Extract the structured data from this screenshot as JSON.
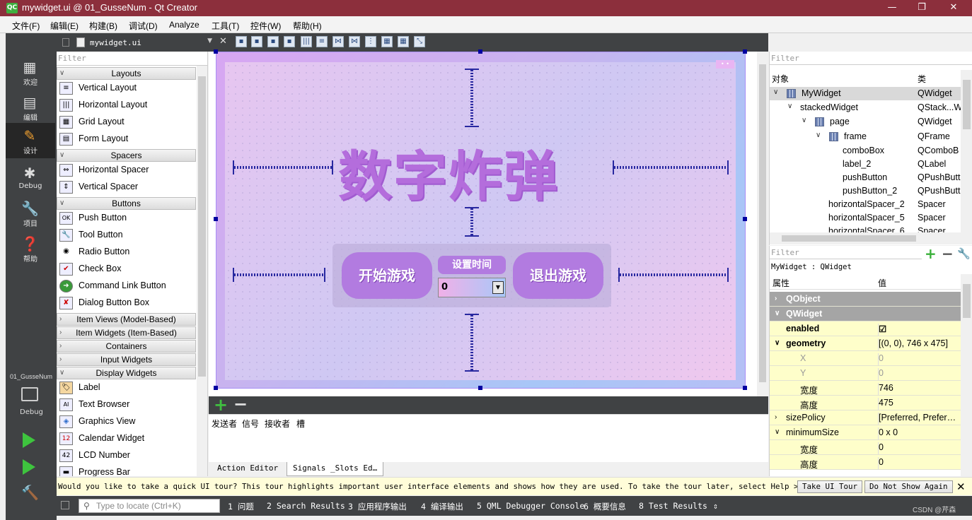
{
  "window": {
    "app_icon": "QC",
    "title": "mywidget.ui @ 01_GusseNum - Qt Creator",
    "min": "—",
    "max": "❐",
    "close": "✕",
    "title_color": "#8c2f3c"
  },
  "menu": [
    "文件(F)",
    "编辑(E)",
    "构建(B)",
    "调试(D)",
    "Analyze",
    "工具(T)",
    "控件(W)",
    "帮助(H)"
  ],
  "modes": [
    {
      "label": "欢迎",
      "icon": "grid-icon"
    },
    {
      "label": "编辑",
      "icon": "document-icon"
    },
    {
      "label": "设计",
      "icon": "pencil-icon"
    },
    {
      "label": "Debug",
      "icon": "bug-icon"
    },
    {
      "label": "项目",
      "icon": "wrench-icon"
    },
    {
      "label": "帮助",
      "icon": "help-icon"
    }
  ],
  "project_name": "01_GusseNum",
  "project_mode": "Debug",
  "doc": {
    "file": "mywidget.ui"
  },
  "widgetbox": {
    "filter_placeholder": "Filter",
    "categories": {
      "layouts": "Layouts",
      "spacers": "Spacers",
      "buttons": "Buttons",
      "item_views": "Item Views (Model-Based)",
      "item_widgets": "Item Widgets (Item-Based)",
      "containers": "Containers",
      "input_widgets": "Input Widgets",
      "display_widgets": "Display Widgets"
    },
    "items": {
      "vertical_layout": "Vertical Layout",
      "horizontal_layout": "Horizontal Layout",
      "grid_layout": "Grid Layout",
      "form_layout": "Form Layout",
      "horizontal_spacer": "Horizontal Spacer",
      "vertical_spacer": "Vertical Spacer",
      "push_button": "Push Button",
      "tool_button": "Tool Button",
      "radio_button": "Radio Button",
      "check_box": "Check Box",
      "command_link_button": "Command Link Button",
      "dialog_button_box": "Dialog Button Box",
      "label": "Label",
      "text_browser": "Text Browser",
      "graphics_view": "Graphics View",
      "calendar_widget": "Calendar Widget",
      "lcd_number": "LCD Number",
      "progress_bar": "Progress Bar"
    }
  },
  "form": {
    "title": "数字炸弹",
    "start_button": "开始游戏",
    "set_time_label": "设置时间",
    "combo_value": "0",
    "quit_button": "退出游戏"
  },
  "signals": {
    "headers": [
      "发送者",
      "信号",
      "接收者",
      "槽"
    ],
    "tabs": [
      "Action Editor",
      "Signals _Slots Ed…"
    ]
  },
  "object_inspector": {
    "filter_placeholder": "Filter",
    "col_object": "对象",
    "col_class": "类",
    "rows": [
      {
        "name": "MyWidget",
        "class": "QWidget"
      },
      {
        "name": "stackedWidget",
        "class": "QStack...W"
      },
      {
        "name": "page",
        "class": "QWidget"
      },
      {
        "name": "frame",
        "class": "QFrame"
      },
      {
        "name": "comboBox",
        "class": "QComboB"
      },
      {
        "name": "label_2",
        "class": "QLabel"
      },
      {
        "name": "pushButton",
        "class": "QPushButt"
      },
      {
        "name": "pushButton_2",
        "class": "QPushButt"
      },
      {
        "name": "horizontalSpacer_2",
        "class": "Spacer"
      },
      {
        "name": "horizontalSpacer_5",
        "class": "Spacer"
      },
      {
        "name": "horizontalSpacer_6",
        "class": "Spacer"
      }
    ]
  },
  "property_editor": {
    "filter_placeholder": "Filter",
    "class_line": "MyWidget : QWidget",
    "col_prop": "属性",
    "col_val": "值",
    "rows": [
      {
        "k": "QObject",
        "v": ""
      },
      {
        "k": "QWidget",
        "v": ""
      },
      {
        "k": "enabled",
        "v": "☑"
      },
      {
        "k": "geometry",
        "v": "[(0, 0), 746 x 475]"
      },
      {
        "k": "X",
        "v": "0"
      },
      {
        "k": "Y",
        "v": "0"
      },
      {
        "k": "宽度",
        "v": "746"
      },
      {
        "k": "高度",
        "v": "475"
      },
      {
        "k": "sizePolicy",
        "v": "[Preferred, Prefer…"
      },
      {
        "k": "minimumSize",
        "v": "0 x 0"
      },
      {
        "k": "宽度",
        "v": "0"
      },
      {
        "k": "高度",
        "v": "0"
      }
    ]
  },
  "tour": {
    "message": "Would you like to take a quick UI tour? This tour highlights important user interface elements and shows how they are used. To take the tour later, select Help > UI Tour.",
    "take": "Take UI Tour",
    "dont": "Do Not Show Again",
    "close": "✕"
  },
  "status": {
    "locate_placeholder": "Type to locate (Ctrl+K)",
    "tabs": [
      "1  问题",
      "2  Search Results",
      "3  应用程序输出",
      "4  编译输出",
      "5  QML Debugger Console",
      "6  概要信息",
      "8  Test Results"
    ],
    "watermark": "CSDN @芹森"
  }
}
